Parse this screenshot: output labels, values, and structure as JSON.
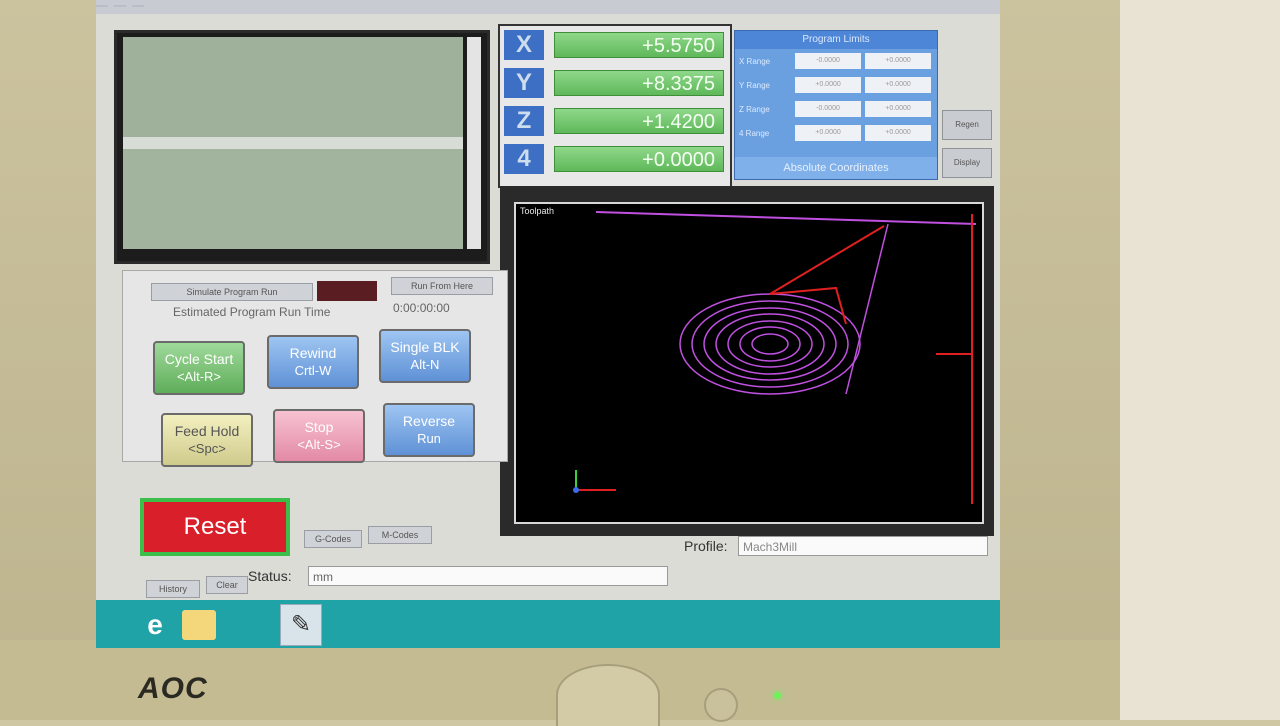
{
  "monitor": {
    "brand": "AOC"
  },
  "dro": {
    "axes": [
      {
        "label": "X",
        "value": "+5.5750"
      },
      {
        "label": "Y",
        "value": "+8.3375"
      },
      {
        "label": "Z",
        "value": "+1.4200"
      },
      {
        "label": "4",
        "value": "+0.0000"
      }
    ]
  },
  "limits": {
    "title": "Program Limits",
    "rows": [
      {
        "name": "X Range",
        "min": "-0.0000",
        "max": "+0.0000"
      },
      {
        "name": "Y Range",
        "min": "+0.0000",
        "max": "+0.0000"
      },
      {
        "name": "Z Range",
        "min": "-0.0000",
        "max": "+0.0000"
      },
      {
        "name": "4 Range",
        "min": "+0.0000",
        "max": "+0.0000"
      }
    ],
    "footer": "Absolute Coordinates"
  },
  "side_buttons": {
    "a": "Regen Toolpath",
    "b": "Display Mode"
  },
  "toolpath": {
    "tag": "Toolpath"
  },
  "run": {
    "simulate": "Simulate Program Run",
    "run_from_here": "Run From Here",
    "est_label": "Estimated Program Run Time",
    "est_value": "0:00:00:00",
    "cycle_start": "Cycle Start",
    "cycle_start_key": "<Alt-R>",
    "rewind": "Rewind",
    "rewind_key": "Crtl-W",
    "single_blk": "Single BLK",
    "single_blk_key": "Alt-N",
    "feed_hold": "Feed Hold",
    "feed_hold_key": "<Spc>",
    "stop": "Stop",
    "stop_key": "<Alt-S>",
    "reverse_run": "Reverse",
    "reverse_run_2": "Run"
  },
  "reset": "Reset",
  "gcodes_btn": "G-Codes",
  "mcodes_btn": "M-Codes",
  "history_btn": "History",
  "clear_btn": "Clear",
  "status_label": "Status:",
  "status_value": "mm",
  "profile_label": "Profile:",
  "profile_value": "Mach3Mill"
}
